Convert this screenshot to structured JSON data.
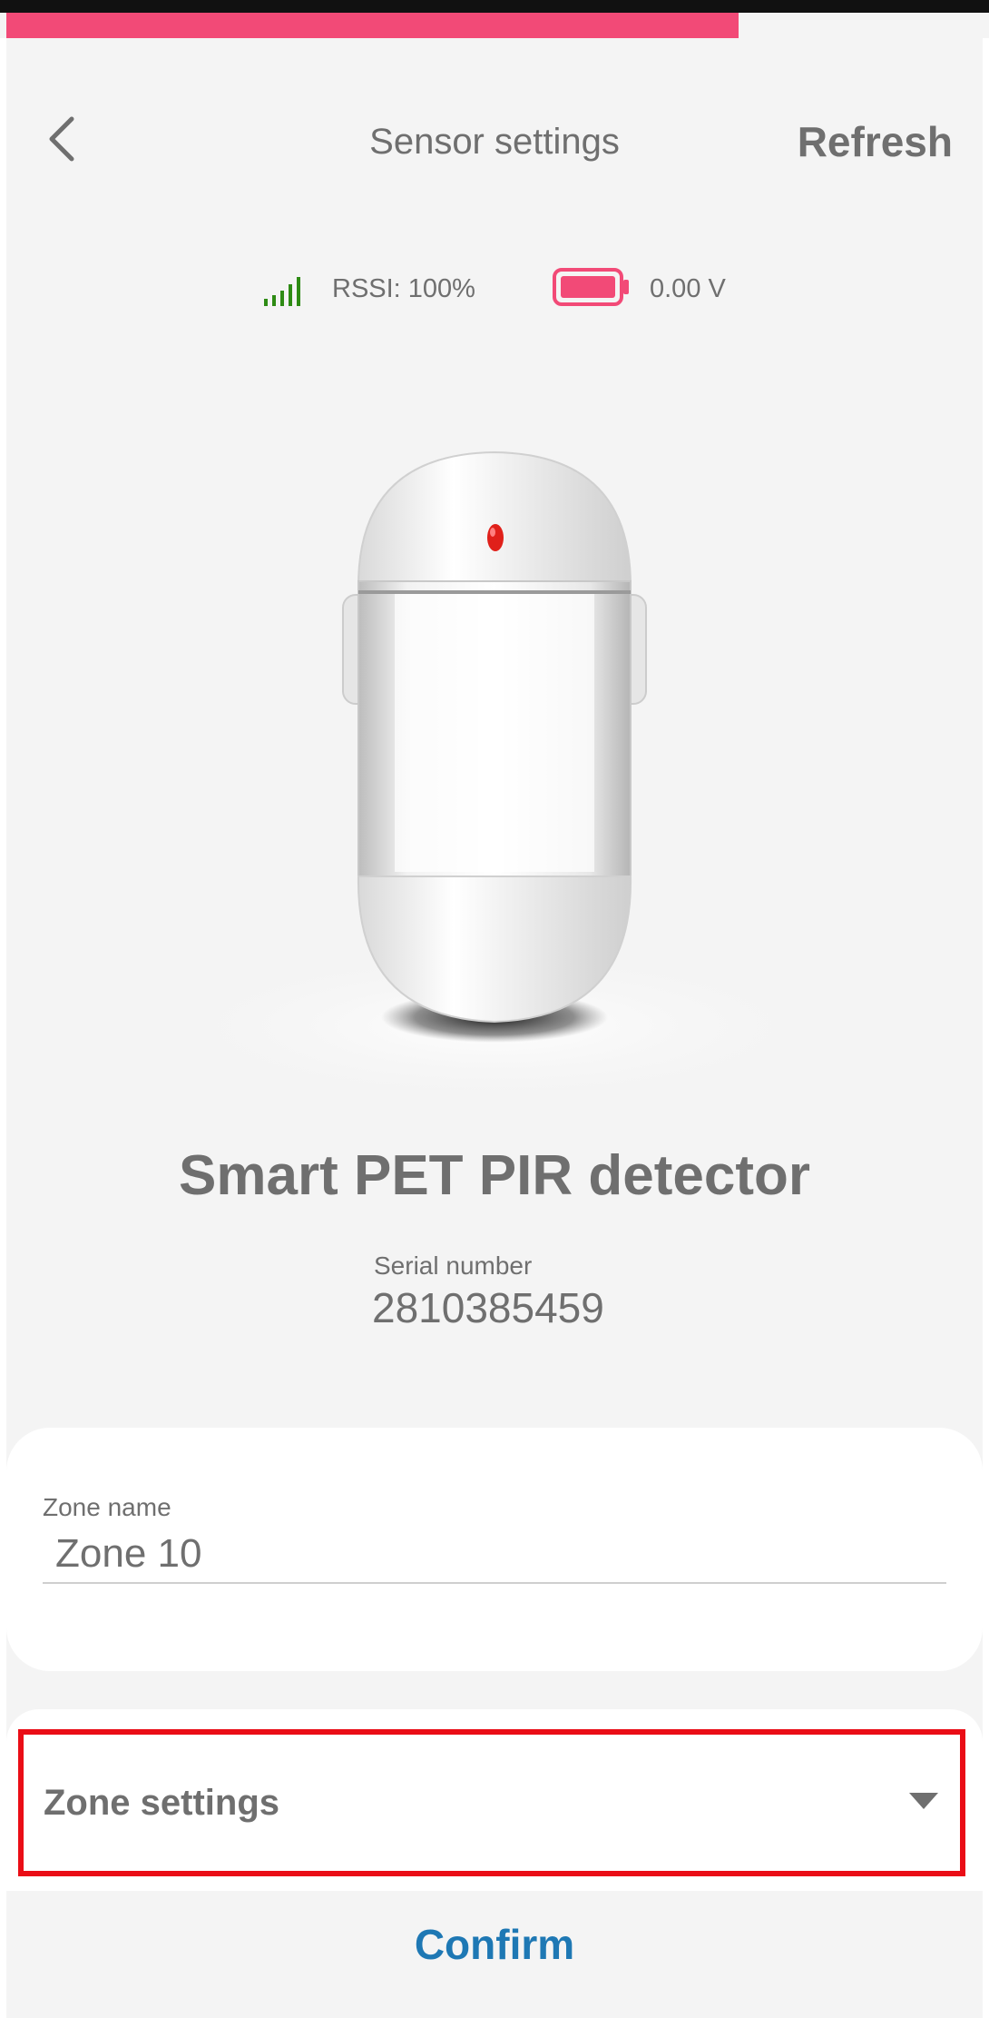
{
  "progress": {
    "fraction": 0.75
  },
  "header": {
    "title": "Sensor settings",
    "refresh_label": "Refresh"
  },
  "status": {
    "rssi_text": "RSSI: 100%",
    "voltage_text": "0.00 V"
  },
  "device": {
    "name": "Smart PET PIR detector",
    "serial_label": "Serial number",
    "serial_value": "2810385459"
  },
  "zone": {
    "label": "Zone name",
    "value": "Zone 10"
  },
  "zone_settings": {
    "label": "Zone settings"
  },
  "actions": {
    "confirm_label": "Confirm"
  },
  "colors": {
    "accent": "#f24a77",
    "text": "#6f6f6f",
    "signal": "#2e8b14",
    "confirm": "#1e78b4",
    "highlight": "#ea0d16"
  },
  "icons": {
    "back": "back-chevron-icon",
    "signal": "signal-strength-icon",
    "battery": "battery-icon",
    "dropdown": "dropdown-arrow-icon"
  }
}
